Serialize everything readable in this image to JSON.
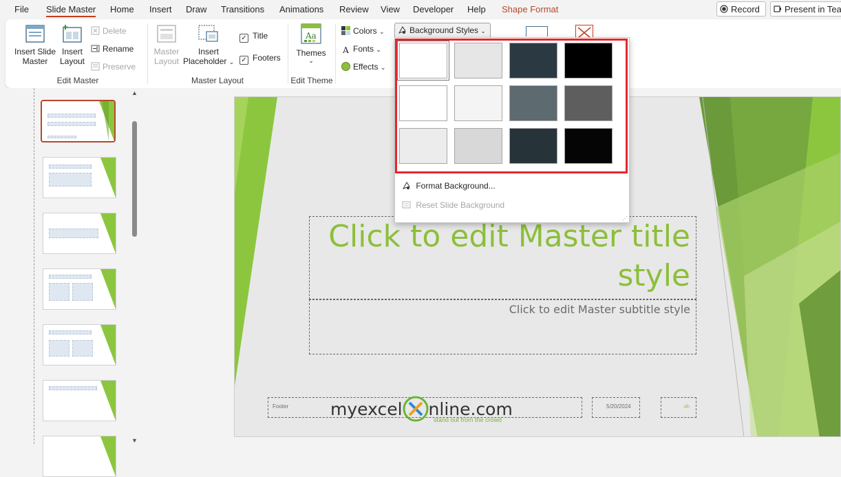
{
  "menu": {
    "items": [
      {
        "label": "File"
      },
      {
        "label": "Slide Master"
      },
      {
        "label": "Home"
      },
      {
        "label": "Insert"
      },
      {
        "label": "Draw"
      },
      {
        "label": "Transitions"
      },
      {
        "label": "Animations"
      },
      {
        "label": "Review"
      },
      {
        "label": "View"
      },
      {
        "label": "Developer"
      },
      {
        "label": "Help"
      },
      {
        "label": "Shape Format"
      }
    ],
    "record_label": "Record",
    "present_label": "Present in Tea"
  },
  "ribbon": {
    "insert_slide_master": "Insert Slide Master",
    "insert_slide_master_l1": "Insert Slide",
    "insert_slide_master_l2": "Master",
    "insert_layout_l1": "Insert",
    "insert_layout_l2": "Layout",
    "delete": "Delete",
    "rename": "Rename",
    "preserve": "Preserve",
    "edit_master_group": "Edit Master",
    "master_layout_l1": "Master",
    "master_layout_l2": "Layout",
    "insert_placeholder_l1": "Insert",
    "insert_placeholder_l2": "Placeholder",
    "title_check": "Title",
    "footers_check": "Footers",
    "master_layout_group": "Master Layout",
    "themes": "Themes",
    "edit_theme_group": "Edit Theme",
    "colors": "Colors",
    "fonts": "Fonts",
    "effects": "Effects",
    "background_styles": "Background Styles"
  },
  "dropdown": {
    "swatches": [
      {
        "color": "#ffffff",
        "selected": true
      },
      {
        "color": "#e6e6e6",
        "selected": false
      },
      {
        "color": "#2b3a42",
        "selected": false
      },
      {
        "color": "#000000",
        "selected": false
      },
      {
        "color": "#ffffff",
        "selected": false
      },
      {
        "color": "#f4f4f4",
        "selected": false
      },
      {
        "color": "#5d6a70",
        "selected": false
      },
      {
        "color": "#5e5e5e",
        "selected": false
      },
      {
        "color": "#ececec",
        "selected": false
      },
      {
        "color": "#d8d8d8",
        "selected": false
      },
      {
        "color": "#26343a",
        "selected": false
      },
      {
        "color": "#050505",
        "selected": false
      }
    ],
    "format_background": "Format Background...",
    "reset_background": "Reset Slide Background"
  },
  "slide": {
    "title": "Click to edit Master title style",
    "title_line1": "Click to edit Master title",
    "title_line2": "style",
    "subtitle": "Click to edit Master subtitle style",
    "footer": "Footer",
    "date": "5/20/2024",
    "slide_number": "‹#›",
    "logo_text_a": "myexcel",
    "logo_text_b": "nline.com",
    "logo_tagline": "stand out from the crowd"
  },
  "colors": {
    "accent": "#b7472a",
    "title_green": "#8cbf3a",
    "highlight_red": "#e3262e"
  }
}
